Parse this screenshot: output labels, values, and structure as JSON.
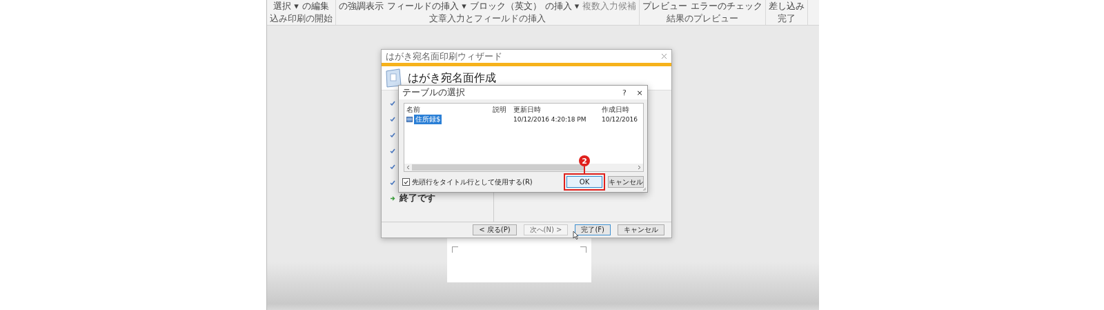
{
  "ribbon": {
    "groups": [
      {
        "label": "込み印刷の開始",
        "commands": [
          {
            "label": "選択 ▾",
            "disabled": false
          },
          {
            "label": "の編集",
            "disabled": false
          }
        ]
      },
      {
        "label": "文章入力とフィールドの挿入",
        "commands": [
          {
            "label": "の強調表示",
            "disabled": false
          },
          {
            "label": "フィールドの挿入 ▾",
            "disabled": false
          },
          {
            "label": "ブロック（英文）",
            "disabled": false
          },
          {
            "label": "の挿入 ▾",
            "disabled": false
          },
          {
            "label": "複数入力候補",
            "disabled": true
          }
        ]
      },
      {
        "label": "結果のプレビュー",
        "commands": [
          {
            "label": "プレビュー",
            "disabled": false
          },
          {
            "label": "エラーのチェック",
            "disabled": false
          }
        ]
      },
      {
        "label": "完了",
        "commands": [
          {
            "label": "差し込み",
            "disabled": false
          }
        ]
      }
    ]
  },
  "wizard": {
    "title": "はがき宛名面印刷ウィザード",
    "heading": "はがき宛名面作成",
    "steps": [
      {
        "checked": true
      },
      {
        "checked": true
      },
      {
        "checked": true
      },
      {
        "checked": true
      },
      {
        "checked": true
      },
      {
        "checked": true
      },
      {
        "label": "終了です",
        "checked": false
      }
    ],
    "buttons": [
      {
        "label": "< 戻る(P)",
        "disabled": false,
        "focused": false
      },
      {
        "label": "次へ(N) >",
        "disabled": true,
        "focused": false
      },
      {
        "label": "完了(F)",
        "disabled": false,
        "focused": true
      },
      {
        "label": "キャンセル",
        "disabled": false,
        "focused": false
      }
    ]
  },
  "table_dialog": {
    "title": "テーブルの選択",
    "help": "?",
    "close": "×",
    "columns": [
      "名前",
      "説明",
      "更新日時",
      "作成日時"
    ],
    "rows": [
      {
        "name": "住所録$",
        "modified": "10/12/2016 4:20:18 PM",
        "created": "10/12/2016",
        "selected": true
      }
    ],
    "checkbox": {
      "label": "先頭行をタイトル行として使用する(R)",
      "checked": true
    },
    "buttons": [
      {
        "label": "OK",
        "highlighted": true
      },
      {
        "label": "キャンセル",
        "highlighted": false
      }
    ]
  },
  "annotation": {
    "badge": "2"
  }
}
